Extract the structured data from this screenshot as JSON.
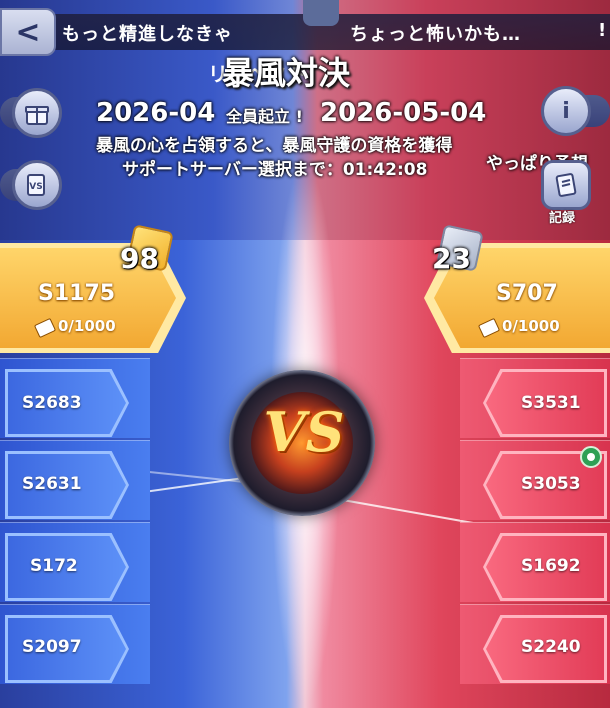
{
  "banner": {
    "left_text": "もっと精進しなきゃ",
    "right_text": "ちょっと怖いかも…",
    "edge_text": "!"
  },
  "header": {
    "overlap_text": "リスペクト!",
    "title": "暴風対決",
    "date_start": "2026-04",
    "date_mid_label": "全員起立 !",
    "date_end": "2026-05-04",
    "subtitle": "暴風の心を占領すると、暴風守護の資格を獲得",
    "countdown": "サポートサーバー選択まで：01:42:08",
    "predict": "やっぱり予想"
  },
  "side_buttons": {
    "back": "<",
    "info": "i",
    "records_label": "記録"
  },
  "left_team": {
    "rank": "98",
    "leader": "S1175",
    "progress": "0/1000",
    "servers": [
      "S2683",
      "S2631",
      "S172",
      "S2097"
    ]
  },
  "right_team": {
    "rank": "23",
    "leader": "S707",
    "progress": "0/1000",
    "servers": [
      "S3531",
      "S3053",
      "S1692",
      "S2240"
    ]
  },
  "vs": {
    "label": "VS"
  },
  "colors": {
    "blue_team": "#3c68e0",
    "red_team": "#e23c57",
    "gold": "#f2a832"
  },
  "icons": [
    "back-arrow-icon",
    "gift-icon",
    "vs-icon",
    "info-icon",
    "records-icon",
    "ticket-icon",
    "dice-icon",
    "online-status-icon"
  ]
}
